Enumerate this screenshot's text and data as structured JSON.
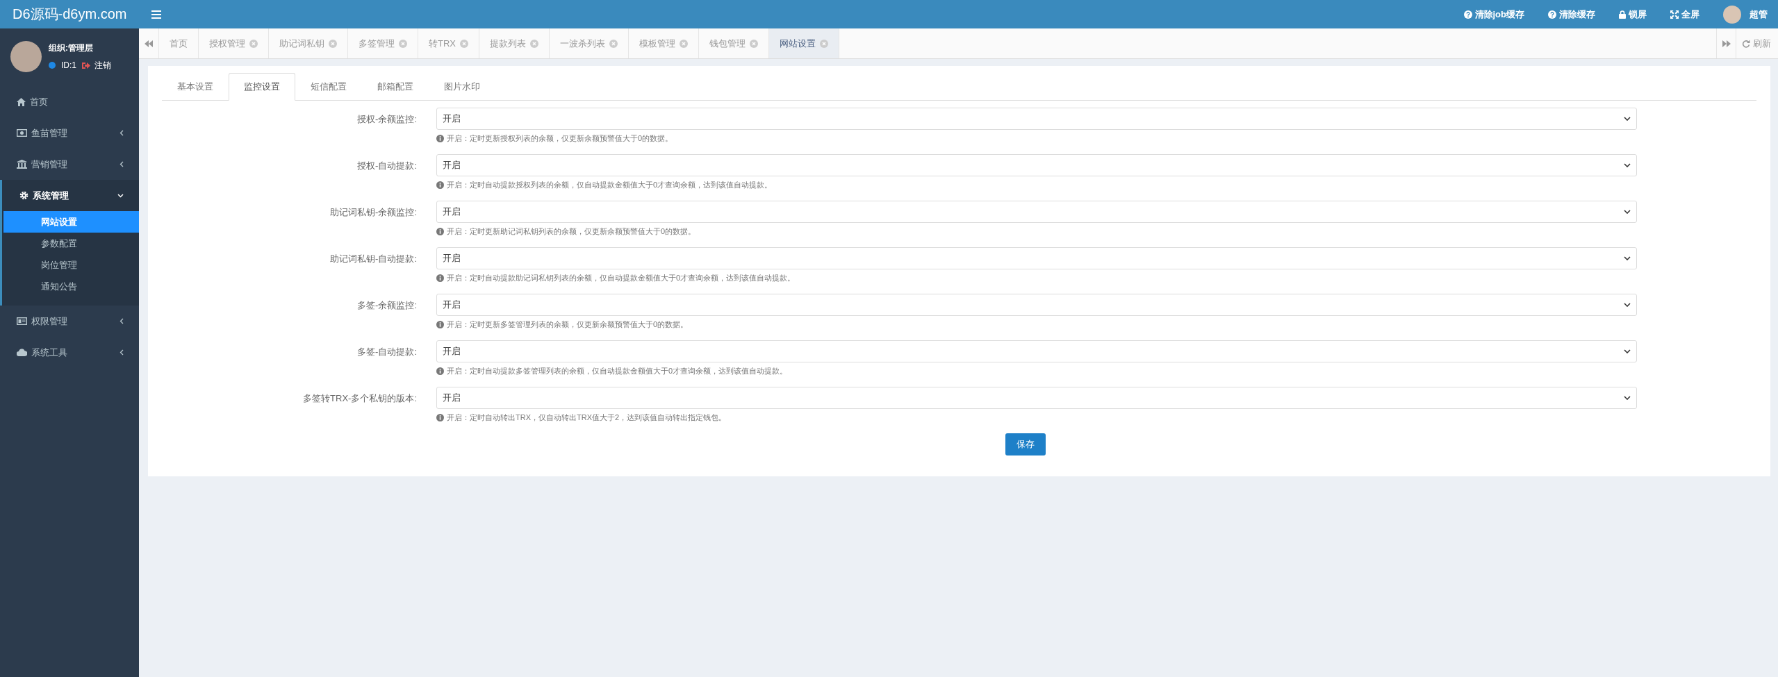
{
  "brand": "D6源码-d6ym.com",
  "header_actions": [
    {
      "kind": "help",
      "label": "清除job缓存"
    },
    {
      "kind": "help",
      "label": "清除缓存"
    },
    {
      "kind": "lock",
      "label": "锁屏"
    },
    {
      "kind": "fullscreen",
      "label": "全屏"
    }
  ],
  "user": {
    "name": "超管"
  },
  "profile": {
    "org": "组织:管理层",
    "id": "ID:1",
    "logout": "注销"
  },
  "sidebar": {
    "items": [
      {
        "kind": "link",
        "label": "首页"
      },
      {
        "kind": "group",
        "label": "鱼苗管理",
        "expanded": false
      },
      {
        "kind": "group",
        "label": "营销管理",
        "expanded": false
      },
      {
        "kind": "group",
        "label": "系统管理",
        "expanded": true,
        "children": [
          {
            "label": "网站设置",
            "selected": true
          },
          {
            "label": "参数配置",
            "selected": false
          },
          {
            "label": "岗位管理",
            "selected": false
          },
          {
            "label": "通知公告",
            "selected": false
          }
        ]
      },
      {
        "kind": "group",
        "label": "权限管理",
        "expanded": false
      },
      {
        "kind": "group",
        "label": "系统工具",
        "expanded": false
      }
    ]
  },
  "page_tabs": [
    {
      "label": "首页",
      "closable": false,
      "selected": false
    },
    {
      "label": "授权管理",
      "closable": true,
      "selected": false
    },
    {
      "label": "助记词私钥",
      "closable": true,
      "selected": false
    },
    {
      "label": "多签管理",
      "closable": true,
      "selected": false
    },
    {
      "label": "转TRX",
      "closable": true,
      "selected": false
    },
    {
      "label": "提款列表",
      "closable": true,
      "selected": false
    },
    {
      "label": "一波杀列表",
      "closable": true,
      "selected": false
    },
    {
      "label": "模板管理",
      "closable": true,
      "selected": false
    },
    {
      "label": "钱包管理",
      "closable": true,
      "selected": false
    },
    {
      "label": "网站设置",
      "closable": true,
      "selected": true
    }
  ],
  "refresh": "刷新",
  "settings_tabs": [
    {
      "label": "基本设置",
      "selected": false
    },
    {
      "label": "监控设置",
      "selected": true
    },
    {
      "label": "短信配置",
      "selected": false
    },
    {
      "label": "邮箱配置",
      "selected": false
    },
    {
      "label": "图片水印",
      "selected": false
    }
  ],
  "fields": [
    {
      "label": "授权-余额监控:",
      "value": "开启",
      "help": "开启：定时更新授权列表的余额，仅更新余额预警值大于0的数据。"
    },
    {
      "label": "授权-自动提款:",
      "value": "开启",
      "help": "开启：定时自动提款授权列表的余额，仅自动提款金额值大于0才查询余额，达到该值自动提款。"
    },
    {
      "label": "助记词私钥-余额监控:",
      "value": "开启",
      "help": "开启：定时更新助记词私钥列表的余额，仅更新余额预警值大于0的数据。"
    },
    {
      "label": "助记词私钥-自动提款:",
      "value": "开启",
      "help": "开启：定时自动提款助记词私钥列表的余额，仅自动提款金额值大于0才查询余额，达到该值自动提款。"
    },
    {
      "label": "多签-余额监控:",
      "value": "开启",
      "help": "开启：定时更新多签管理列表的余额，仅更新余额预警值大于0的数据。"
    },
    {
      "label": "多签-自动提款:",
      "value": "开启",
      "help": "开启：定时自动提款多签管理列表的余额，仅自动提款金额值大于0才查询余额，达到该值自动提款。"
    },
    {
      "label": "多签转TRX-多个私钥的版本:",
      "value": "开启",
      "help": "开启：定时自动转出TRX，仅自动转出TRX值大于2，达到该值自动转出指定钱包。"
    }
  ],
  "save_button": "保存"
}
